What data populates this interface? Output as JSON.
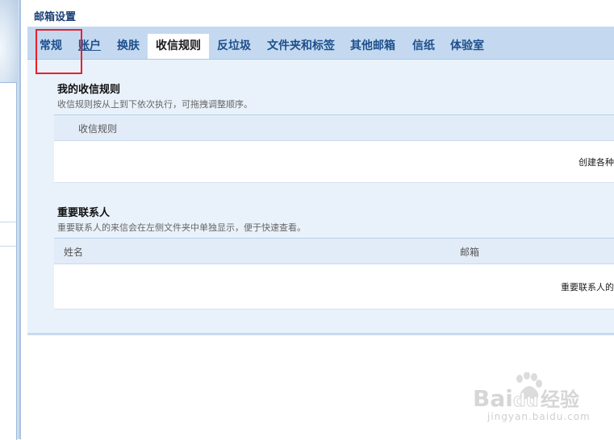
{
  "page": {
    "title": "邮箱设置"
  },
  "tabs": [
    {
      "label": "常规",
      "active": false
    },
    {
      "label": "账户",
      "active": false
    },
    {
      "label": "换肤",
      "active": false
    },
    {
      "label": "收信规则",
      "active": true
    },
    {
      "label": "反垃圾",
      "active": false
    },
    {
      "label": "文件夹和标签",
      "active": false
    },
    {
      "label": "其他邮箱",
      "active": false
    },
    {
      "label": "信纸",
      "active": false
    },
    {
      "label": "体验室",
      "active": false
    }
  ],
  "rules_section": {
    "title": "我的收信规则",
    "description": "收信规则按从上到下依次执行，可拖拽调整顺序。",
    "table": {
      "columns": [
        "收信规则"
      ],
      "empty_text": "创建各种"
    }
  },
  "contacts_section": {
    "title": "重要联系人",
    "description": "重要联系人的来信会在左侧文件夹中单独显示，便于快速查看。",
    "table": {
      "columns": [
        "姓名",
        "邮箱"
      ],
      "empty_text": "重要联系人的"
    }
  },
  "watermark": {
    "logo": "Baidu经验",
    "url": "jingyan.baidu.com"
  },
  "colors": {
    "accent": "#1d4f8c",
    "tab_bar": "#c4d9f0",
    "highlight": "#e8202a"
  }
}
